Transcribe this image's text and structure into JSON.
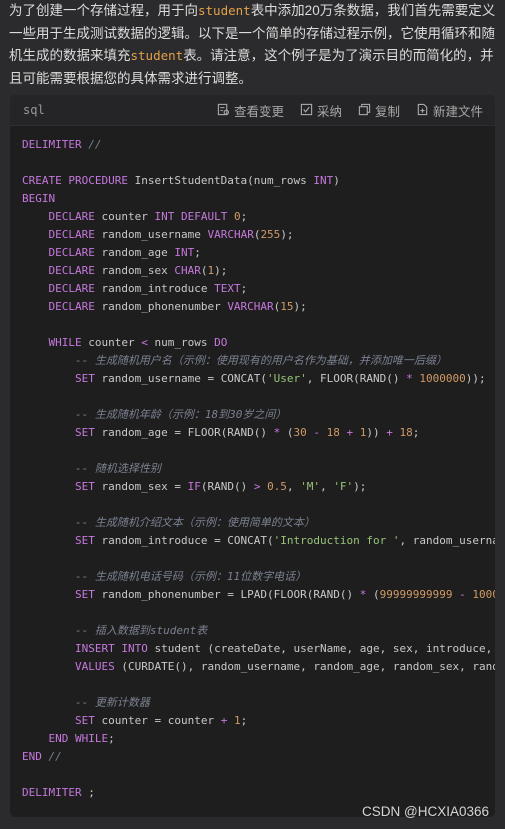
{
  "intro": {
    "p1": "为了创建一个存储过程，用于向",
    "kw1": "student",
    "p2": "表中添加20万条数据，我们首先需要定义一些用于生成测试数据的逻辑。以下是一个简单的存储过程示例，它使用循环和随机生成的数据来填充",
    "kw2": "student",
    "p3": "表。请注意，这个例子是为了演示目的而简化的，并且可能需要根据您的具体需求进行调整。"
  },
  "codeblock": {
    "language": "sql",
    "tools": {
      "view_changes": "查看变更",
      "adopt": "采纳",
      "copy": "复制",
      "new_file": "新建文件"
    },
    "lines": {
      "l1": {
        "k1": "DELIMITER",
        "c1": " //"
      },
      "l3": {
        "k1": "CREATE PROCEDURE",
        "t1": " InsertStudentData(num_rows ",
        "k2": "INT",
        "t2": ")"
      },
      "l4": {
        "k1": "BEGIN"
      },
      "l5": {
        "i": "    ",
        "k1": "DECLARE",
        "t1": " counter ",
        "k2": "INT DEFAULT",
        "t2": " ",
        "n1": "0",
        "t3": ";"
      },
      "l6": {
        "i": "    ",
        "k1": "DECLARE",
        "t1": " random_username ",
        "k2": "VARCHAR",
        "t2": "(",
        "n1": "255",
        "t3": ");"
      },
      "l7": {
        "i": "    ",
        "k1": "DECLARE",
        "t1": " random_age ",
        "k2": "INT",
        "t2": ";"
      },
      "l8": {
        "i": "    ",
        "k1": "DECLARE",
        "t1": " random_sex ",
        "k2": "CHAR",
        "t2": "(",
        "n1": "1",
        "t3": ");"
      },
      "l9": {
        "i": "    ",
        "k1": "DECLARE",
        "t1": " random_introduce ",
        "k2": "TEXT",
        "t2": ";"
      },
      "l10": {
        "i": "    ",
        "k1": "DECLARE",
        "t1": " random_phonenumber ",
        "k2": "VARCHAR",
        "t2": "(",
        "n1": "15",
        "t3": ");"
      },
      "l12": {
        "i": "    ",
        "k1": "WHILE",
        "t1": " counter ",
        "k2": "<",
        "t2": " num_rows ",
        "k3": "DO"
      },
      "l13": {
        "i": "        ",
        "c1": "-- 生成随机用户名（示例：使用现有的用户名作为基础，并添加唯一后缀）"
      },
      "l14": {
        "i": "        ",
        "k1": "SET",
        "t1": " random_username = CONCAT(",
        "s1": "'User'",
        "t2": ", FLOOR(RAND() ",
        "k2": "*",
        "t3": " ",
        "n1": "1000000",
        "t4": "));"
      },
      "l16": {
        "i": "        ",
        "c1": "-- 生成随机年龄（示例：18到30岁之间）"
      },
      "l17": {
        "i": "        ",
        "k1": "SET",
        "t1": " random_age = FLOOR(RAND() ",
        "k2": "*",
        "t2": " (",
        "n1": "30",
        "t3": " ",
        "k3": "-",
        "t4": " ",
        "n2": "18",
        "t5": " ",
        "k4": "+",
        "t6": " ",
        "n3": "1",
        "t7": ")) ",
        "k5": "+",
        "t8": " ",
        "n4": "18",
        "t9": ";"
      },
      "l19": {
        "i": "        ",
        "c1": "-- 随机选择性别"
      },
      "l20": {
        "i": "        ",
        "k1": "SET",
        "t1": " random_sex = ",
        "k2": "IF",
        "t2": "(RAND() ",
        "k3": ">",
        "t3": " ",
        "n1": "0.5",
        "t4": ", ",
        "s1": "'M'",
        "t5": ", ",
        "s2": "'F'",
        "t6": ");"
      },
      "l22": {
        "i": "        ",
        "c1": "-- 生成随机介绍文本（示例：使用简单的文本）"
      },
      "l23": {
        "i": "        ",
        "k1": "SET",
        "t1": " random_introduce = CONCAT(",
        "s1": "'Introduction for '",
        "t2": ", random_userna"
      },
      "l25": {
        "i": "        ",
        "c1": "-- 生成随机电话号码（示例：11位数字电话）"
      },
      "l26": {
        "i": "        ",
        "k1": "SET",
        "t1": " random_phonenumber = LPAD(FLOOR(RAND() ",
        "k2": "*",
        "t2": " (",
        "n1": "99999999999",
        "t3": " ",
        "k3": "-",
        "t4": " ",
        "n2": "1000"
      },
      "l28": {
        "i": "        ",
        "c1": "-- 插入数据到student表"
      },
      "l29": {
        "i": "        ",
        "k1": "INSERT INTO",
        "t1": " student (createDate, userName, age, sex, introduce,"
      },
      "l30": {
        "i": "        ",
        "k1": "VALUES",
        "t1": " (CURDATE(), random_username, random_age, random_sex, rand"
      },
      "l32": {
        "i": "        ",
        "c1": "-- 更新计数器"
      },
      "l33": {
        "i": "        ",
        "k1": "SET",
        "t1": " counter = counter ",
        "k2": "+",
        "t2": " ",
        "n1": "1",
        "t3": ";"
      },
      "l34": {
        "i": "    ",
        "k1": "END WHILE",
        "t1": ";"
      },
      "l35": {
        "k1": "END",
        "c1": " //"
      },
      "l37": {
        "k1": "DELIMITER",
        "t1": " ;"
      }
    }
  },
  "watermark": "CSDN @HCXIA0366",
  "colors": {
    "background": "#2b2b2d",
    "code_background": "#1e1e1f",
    "keyword": "#c678dd",
    "number": "#d19a66",
    "string": "#98c379",
    "comment": "#7b8190",
    "inline_code": "#e3a14a"
  }
}
